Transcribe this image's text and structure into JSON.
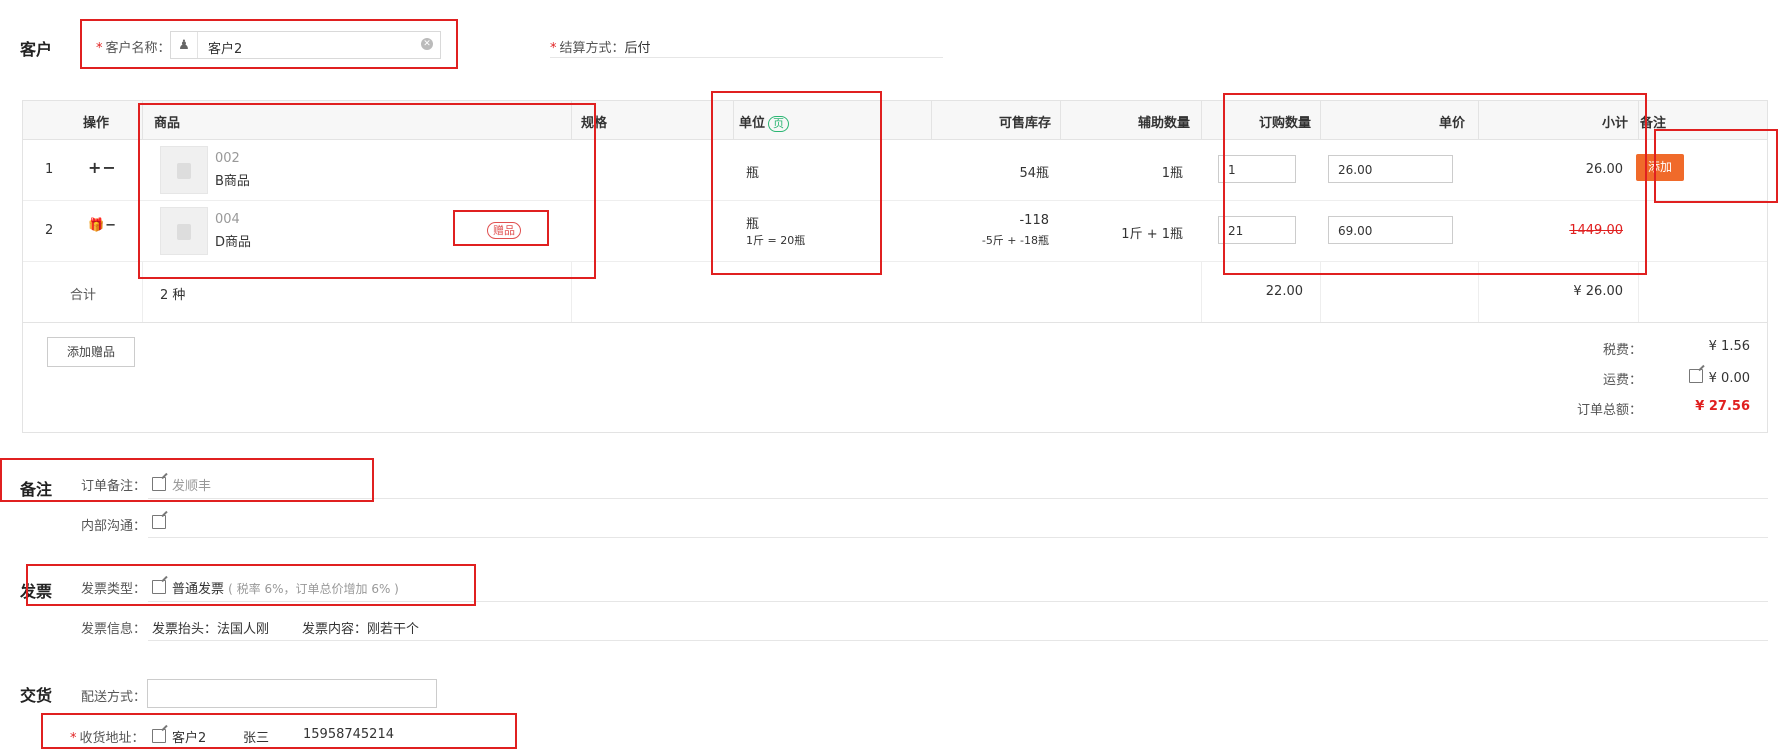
{
  "customer_section": {
    "title": "客户",
    "customer_name_label": "客户名称：",
    "customer_name_value": "客户2",
    "settlement_label": "结算方式：",
    "settlement_value": "后付"
  },
  "table": {
    "headers": {
      "index": "",
      "operation": "操作",
      "product": "商品",
      "spec": "规格",
      "unit": "单位",
      "unit_badge": "页",
      "stock": "可售库存",
      "aux_qty": "辅助数量",
      "order_qty": "订购数量",
      "price": "单价",
      "subtotal": "小计",
      "remark": "备注"
    },
    "rows": [
      {
        "index": "1",
        "code": "002",
        "name": "B商品",
        "unit": "瓶",
        "unit_sub": "",
        "stock": "54瓶",
        "stock_sub": "",
        "aux_qty": "1瓶",
        "order_qty": "1",
        "price": "26.00",
        "subtotal": "26.00",
        "gift_badge": ""
      },
      {
        "index": "2",
        "code": "004",
        "name": "D商品",
        "unit": "瓶",
        "unit_sub": "1斤 = 20瓶",
        "stock": "-118",
        "stock_sub": "-5斤 + -18瓶",
        "aux_qty": "1斤 + 1瓶",
        "order_qty": "21",
        "price": "69.00",
        "subtotal": "1449.00",
        "gift_badge": "赠品"
      }
    ],
    "add_button": "添加",
    "total_label": "合计",
    "total_kinds": "2 种",
    "total_qty": "22.00",
    "total_amount": "¥ 26.00"
  },
  "fees": {
    "add_gift_button": "添加赠品",
    "tax_label": "税费：",
    "tax_value": "¥ 1.56",
    "shipping_label": "运费：",
    "shipping_value": "¥ 0.00",
    "order_total_label": "订单总额：",
    "order_total_value": "¥ 27.56"
  },
  "remark_section": {
    "title": "备注",
    "order_remark_label": "订单备注：",
    "order_remark_value": "发顺丰",
    "internal_label": "内部沟通："
  },
  "invoice_section": {
    "title": "发票",
    "type_label": "发票类型：",
    "type_value": "普通发票",
    "type_note": "( 税率 6%，订单总价增加 6% )",
    "info_label": "发票信息：",
    "info_header": "发票抬头：法国人刚",
    "info_content": "发票内容：刚若干个"
  },
  "delivery_section": {
    "title": "交货",
    "method_label": "配送方式：",
    "address_label": "收货地址：",
    "address_name": "客户2",
    "address_contact": "张三",
    "address_phone": "15958745214"
  },
  "colors": {
    "accent_orange": "#f06a2a",
    "highlight_red": "#e02020",
    "badge_green": "#2bb673",
    "total_red": "#e02020"
  }
}
